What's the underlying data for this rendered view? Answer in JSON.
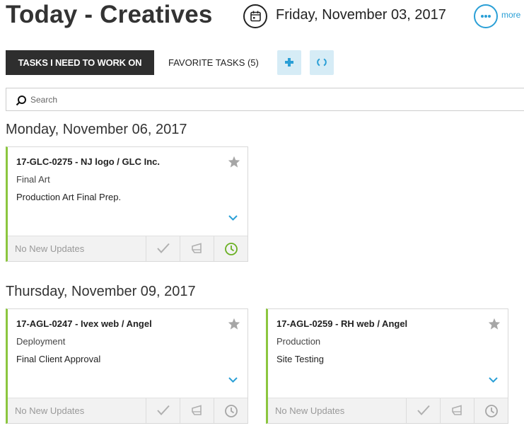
{
  "header": {
    "title": "Today - Creatives",
    "date": "Friday, November 03, 2017",
    "more_label": "more"
  },
  "tabs": {
    "active_label": "TASKS I NEED TO WORK ON",
    "favorites_label": "FAVORITE TASKS (5)"
  },
  "search": {
    "placeholder": "Search",
    "value": ""
  },
  "colors": {
    "accent": "#2a9fd6",
    "card_border": "#8cc63f",
    "active_tab": "#2e2e2e",
    "icon_button_bg": "#d6ecf6"
  },
  "days": [
    {
      "heading": "Monday, November 06, 2017",
      "cards": [
        {
          "title": "17-GLC-0275 - NJ logo / GLC Inc.",
          "phase": "Final Art",
          "task": "Production Art Final Prep.",
          "status": "No New Updates",
          "clock_active": true
        }
      ]
    },
    {
      "heading": "Thursday, November 09, 2017",
      "cards": [
        {
          "title": "17-AGL-0247 - Ivex web / Angel",
          "phase": "Deployment",
          "task": "Final Client Approval",
          "status": "No New Updates",
          "clock_active": false
        },
        {
          "title": "17-AGL-0259 - RH web / Angel",
          "phase": "Production",
          "task": "Site Testing",
          "status": "No New Updates",
          "clock_active": false
        }
      ]
    }
  ]
}
